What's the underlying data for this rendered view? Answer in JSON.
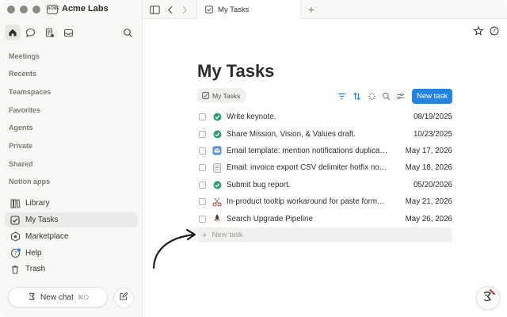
{
  "workspace": {
    "name": "Acme Labs",
    "logo_text": "ACME"
  },
  "sidebar": {
    "sections": [
      "Meetings",
      "Recents",
      "Teamspaces",
      "Favorites",
      "Agents",
      "Private",
      "Shared",
      "Notion apps"
    ],
    "items": [
      {
        "label": "Library",
        "icon": "library-icon"
      },
      {
        "label": "My Tasks",
        "icon": "checkbox-icon",
        "active": true
      },
      {
        "label": "Marketplace",
        "icon": "marketplace-icon"
      },
      {
        "label": "Help",
        "icon": "help-icon"
      },
      {
        "label": "Trash",
        "icon": "trash-icon"
      }
    ],
    "new_chat": {
      "label": "New chat",
      "shortcut": "⌘O"
    }
  },
  "tabbar": {
    "tab_title": "My Tasks",
    "add_label": "+"
  },
  "page": {
    "title": "My Tasks",
    "view_tab": "My Tasks",
    "new_task_button": "New task",
    "new_row_placeholder": "New task",
    "tasks": [
      {
        "title": "Write keynote.",
        "date": "08/19/2025",
        "icon": "check-circle-icon"
      },
      {
        "title": "Share Mission, Vision, & Values draft.",
        "date": "10/23/2025",
        "icon": "check-circle-icon"
      },
      {
        "title": "Email template: mention notifications duplicated",
        "date": "May 17, 2026",
        "icon": "email-app-icon"
      },
      {
        "title": "Email: invoice export CSV delimiter hotfix notice",
        "date": "May 18, 2026",
        "icon": "document-icon"
      },
      {
        "title": "Submit bug report.",
        "date": "05/20/2026",
        "icon": "check-circle-icon"
      },
      {
        "title": "In-product tooltip workaround for paste formatting",
        "date": "May 21, 2026",
        "icon": "scissors-icon"
      },
      {
        "title": "Search Upgrade Pipeline",
        "date": "May 26, 2026",
        "icon": "rocket-icon"
      }
    ]
  },
  "colors": {
    "accent": "#2383e2",
    "done_green": "#2e9e6a",
    "sidebar_bg": "#f7f7f5"
  }
}
